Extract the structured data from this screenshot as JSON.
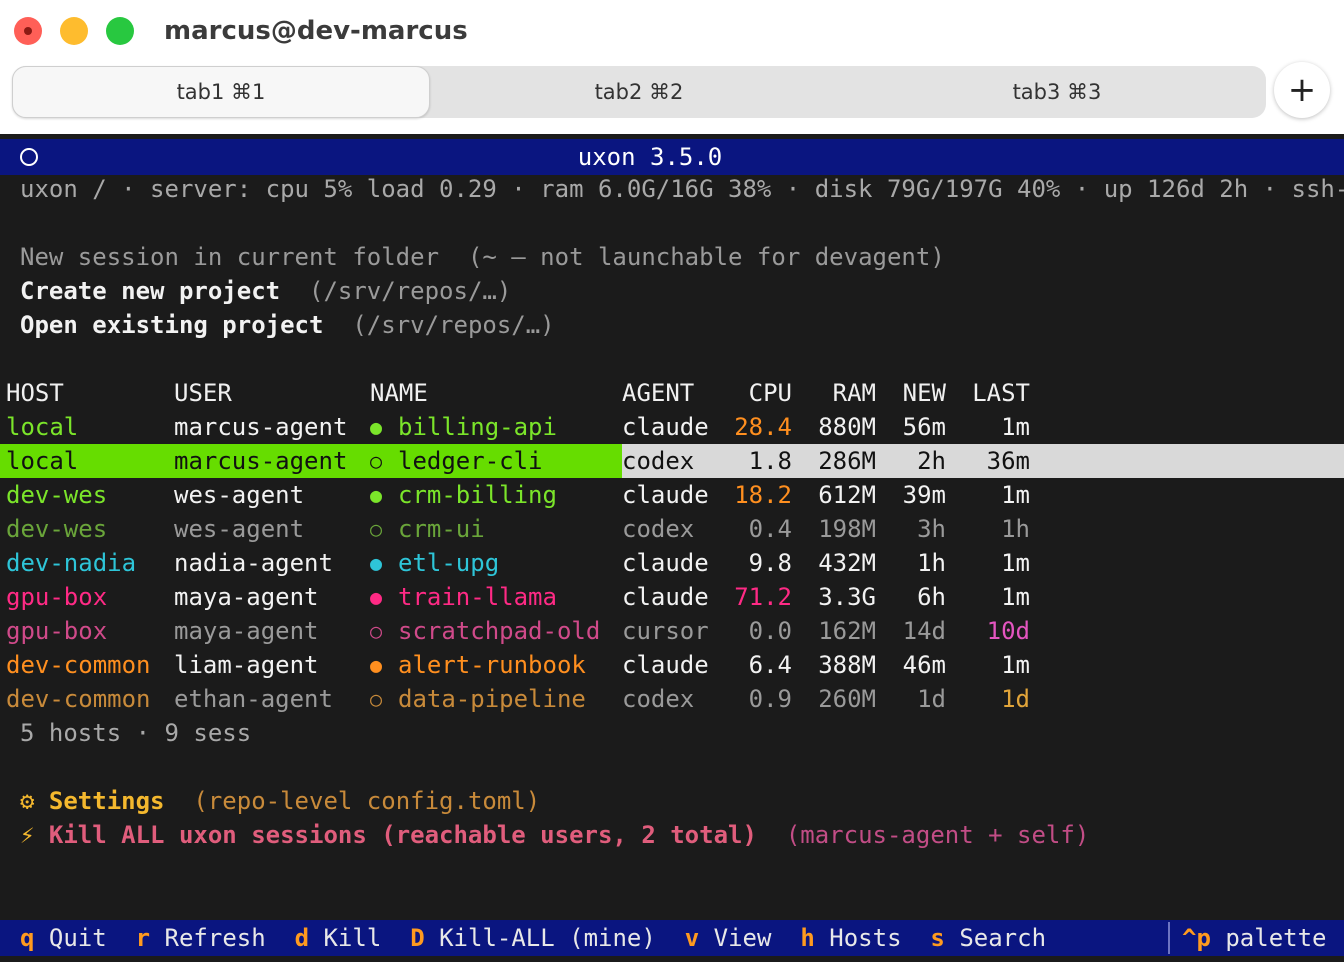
{
  "window": {
    "title": "marcus@dev-marcus",
    "tabs": [
      {
        "label": "tab1 ⌘1",
        "active": true
      },
      {
        "label": "tab2 ⌘2",
        "active": false
      },
      {
        "label": "tab3 ⌘3",
        "active": false
      }
    ],
    "new_tab_label": "+"
  },
  "terminal": {
    "app_title": "uxon 3.5.0",
    "status_line": "uxon / · server: cpu 5% load 0.29 · ram 6.0G/16G 38% · disk 79G/197G 40% · up 126d 2h · ssh-l",
    "menu": [
      {
        "label": "New session in current folder",
        "hint": "(~ — not launchable for devagent)"
      },
      {
        "label": "Create new project",
        "hint": "(/srv/repos/…)"
      },
      {
        "label": "Open existing project",
        "hint": "(/srv/repos/…)"
      }
    ],
    "table": {
      "headers": {
        "host": "HOST",
        "user": "USER",
        "name": "NAME",
        "agent": "AGENT",
        "cpu": "CPU",
        "ram": "RAM",
        "new": "NEW",
        "last": "LAST"
      },
      "rows": [
        {
          "host": "local",
          "user": "marcus-agent",
          "dot": "●",
          "name": "billing-api",
          "agent": "claude",
          "cpu": "28.4",
          "ram": "880M",
          "new": "56m",
          "last": "1m"
        },
        {
          "host": "local",
          "user": "marcus-agent",
          "dot": "○",
          "name": "ledger-cli",
          "agent": "codex",
          "cpu": "1.8",
          "ram": "286M",
          "new": "2h",
          "last": "36m"
        },
        {
          "host": "dev-wes",
          "user": "wes-agent",
          "dot": "●",
          "name": "crm-billing",
          "agent": "claude",
          "cpu": "18.2",
          "ram": "612M",
          "new": "39m",
          "last": "1m"
        },
        {
          "host": "dev-wes",
          "user": "wes-agent",
          "dot": "○",
          "name": "crm-ui",
          "agent": "codex",
          "cpu": "0.4",
          "ram": "198M",
          "new": "3h",
          "last": "1h"
        },
        {
          "host": "dev-nadia",
          "user": "nadia-agent",
          "dot": "●",
          "name": "etl-upg",
          "agent": "claude",
          "cpu": "9.8",
          "ram": "432M",
          "new": "1h",
          "last": "1m"
        },
        {
          "host": "gpu-box",
          "user": "maya-agent",
          "dot": "●",
          "name": "train-llama",
          "agent": "claude",
          "cpu": "71.2",
          "ram": "3.3G",
          "new": "6h",
          "last": "1m"
        },
        {
          "host": "gpu-box",
          "user": "maya-agent",
          "dot": "○",
          "name": "scratchpad-old",
          "agent": "cursor",
          "cpu": "0.0",
          "ram": "162M",
          "new": "14d",
          "last": "10d"
        },
        {
          "host": "dev-common",
          "user": "liam-agent",
          "dot": "●",
          "name": "alert-runbook",
          "agent": "claude",
          "cpu": "6.4",
          "ram": "388M",
          "new": "46m",
          "last": "1m"
        },
        {
          "host": "dev-common",
          "user": "ethan-agent",
          "dot": "○",
          "name": "data-pipeline",
          "agent": "codex",
          "cpu": "0.9",
          "ram": "260M",
          "new": "1d",
          "last": "1d"
        }
      ]
    },
    "summary": "5 hosts · 9 sess",
    "settings": {
      "icon": "⚙",
      "label": "Settings",
      "hint": "(repo-level config.toml)"
    },
    "kill_all": {
      "icon": "⚡",
      "label": "Kill ALL uxon sessions (reachable users, 2 total)",
      "hint": "(marcus-agent + self)"
    },
    "footer": {
      "keys": [
        {
          "key": "q",
          "label": "Quit"
        },
        {
          "key": "r",
          "label": "Refresh"
        },
        {
          "key": "d",
          "label": "Kill"
        },
        {
          "key": "D",
          "label": "Kill-ALL (mine)"
        },
        {
          "key": "v",
          "label": "View"
        },
        {
          "key": "h",
          "label": "Hosts"
        },
        {
          "key": "s",
          "label": "Search"
        }
      ],
      "palette_key": "^p",
      "palette_label": "palette"
    }
  }
}
